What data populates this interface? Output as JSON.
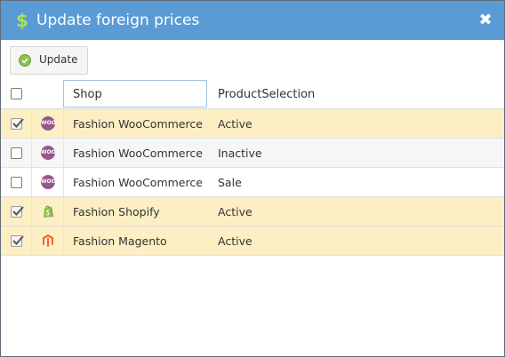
{
  "dialog": {
    "title": "Update foreign prices",
    "title_icon": "dollar-icon",
    "close_icon": "close-icon",
    "close_glyph": "✖"
  },
  "toolbar": {
    "update_label": "Update",
    "update_icon": "check-circle-icon"
  },
  "grid": {
    "columns": [
      "",
      "",
      "Shop",
      "ProductSelection"
    ],
    "shop_filter_value": "Shop",
    "rows": [
      {
        "checked": true,
        "logo": "woocommerce-logo",
        "logo_text": "WOO",
        "shop": "Fashion WooCommerce",
        "selection": "Active"
      },
      {
        "checked": false,
        "logo": "woocommerce-logo",
        "logo_text": "WOO",
        "shop": "Fashion WooCommerce",
        "selection": "Inactive"
      },
      {
        "checked": false,
        "logo": "woocommerce-logo",
        "logo_text": "WOO",
        "shop": "Fashion WooCommerce",
        "selection": "Sale"
      },
      {
        "checked": true,
        "logo": "shopify-logo",
        "logo_text": "",
        "shop": "Fashion Shopify",
        "selection": "Active"
      },
      {
        "checked": true,
        "logo": "magento-logo",
        "logo_text": "",
        "shop": "Fashion Magento",
        "selection": "Active"
      }
    ]
  },
  "colors": {
    "titlebar": "#5b9bd5",
    "selected_row": "#fcefc4",
    "woocommerce": "#96588a",
    "shopify": "#95bf47",
    "magento": "#f26322"
  }
}
